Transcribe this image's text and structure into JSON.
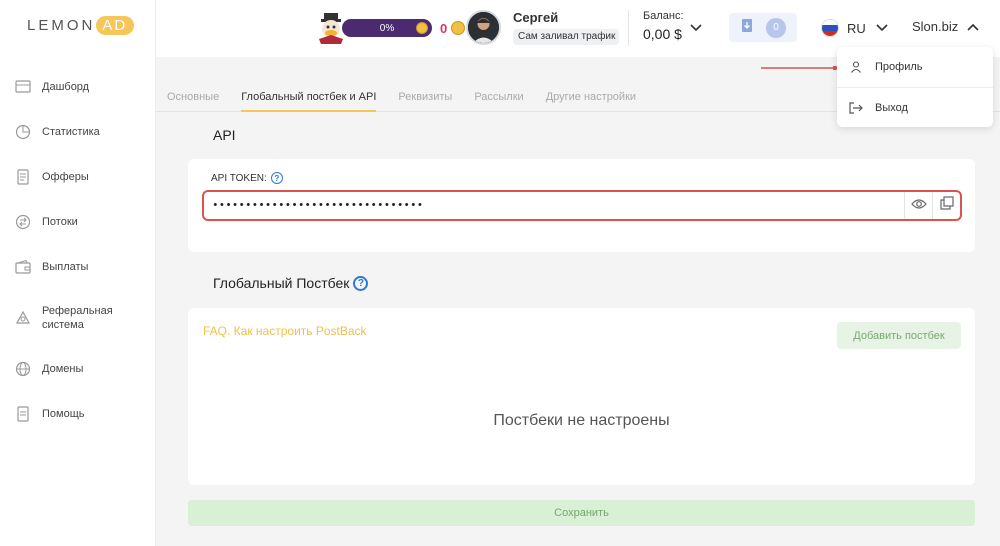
{
  "brand": {
    "logo_main": "LEMON",
    "logo_accent": "AD"
  },
  "sidebar": {
    "items": [
      {
        "label": "Дашборд",
        "icon": "dashboard-icon"
      },
      {
        "label": "Статистика",
        "icon": "statistics-icon"
      },
      {
        "label": "Офферы",
        "icon": "offers-icon"
      },
      {
        "label": "Потоки",
        "icon": "flows-icon"
      },
      {
        "label": "Выплаты",
        "icon": "wallet-icon"
      },
      {
        "label": "Реферальная система",
        "icon": "referral-icon"
      },
      {
        "label": "Домены",
        "icon": "globe-icon"
      },
      {
        "label": "Помощь",
        "icon": "help-doc-icon"
      }
    ]
  },
  "header": {
    "game_progress": "0%",
    "game_coins": "0",
    "user_name": "Сергей",
    "user_status": "Сам заливал трафик",
    "balance_label": "Баланс:",
    "balance_value": "0,00 $",
    "notifications_count": "0",
    "language": "RU",
    "site": "Slon.biz"
  },
  "tabs": [
    {
      "label": "Основные",
      "active": false
    },
    {
      "label": "Глобальный постбек и API",
      "active": true
    },
    {
      "label": "Реквизиты",
      "active": false
    },
    {
      "label": "Рассылки",
      "active": false
    },
    {
      "label": "Другие настройки",
      "active": false
    }
  ],
  "api": {
    "title": "API",
    "token_label": "API TOKEN:",
    "token_value": "••••••••••••••••••••••••••••••••"
  },
  "postback": {
    "title": "Глобальный Постбек",
    "faq_link": "FAQ. Как настроить PostBack",
    "add_button": "Добавить постбек",
    "empty_text": "Постбеки не настроены"
  },
  "save_button": "Сохранить",
  "dropdown": {
    "profile": "Профиль",
    "logout": "Выход"
  },
  "colors": {
    "accent": "#f6c65b",
    "error_border": "#d9534f",
    "success_bg": "#d9efd6",
    "link": "#f0c04a"
  }
}
